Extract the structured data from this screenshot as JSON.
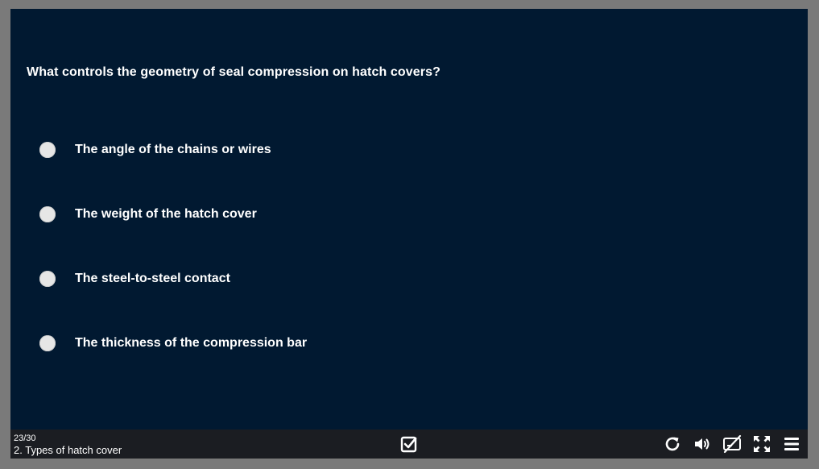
{
  "question": {
    "text": "What controls the geometry of seal compression on hatch covers?"
  },
  "options": [
    {
      "label": "The angle of the chains or wires"
    },
    {
      "label": "The weight of the hatch cover"
    },
    {
      "label": "The steel-to-steel contact"
    },
    {
      "label": "The thickness of the compression bar"
    }
  ],
  "footer": {
    "progress": "23/30",
    "section_title": "2. Types of hatch cover"
  },
  "icons": {
    "submit": "checkbox-check-icon",
    "replay": "replay-icon",
    "volume": "volume-icon",
    "captions": "captions-off-icon",
    "fullscreen": "fullscreen-icon",
    "menu": "menu-icon"
  },
  "colors": {
    "background": "#011931",
    "outer_frame": "#7a7a7a",
    "footer": "#1b1d22",
    "text": "#ffffff",
    "radio": "#e6e6e6"
  }
}
